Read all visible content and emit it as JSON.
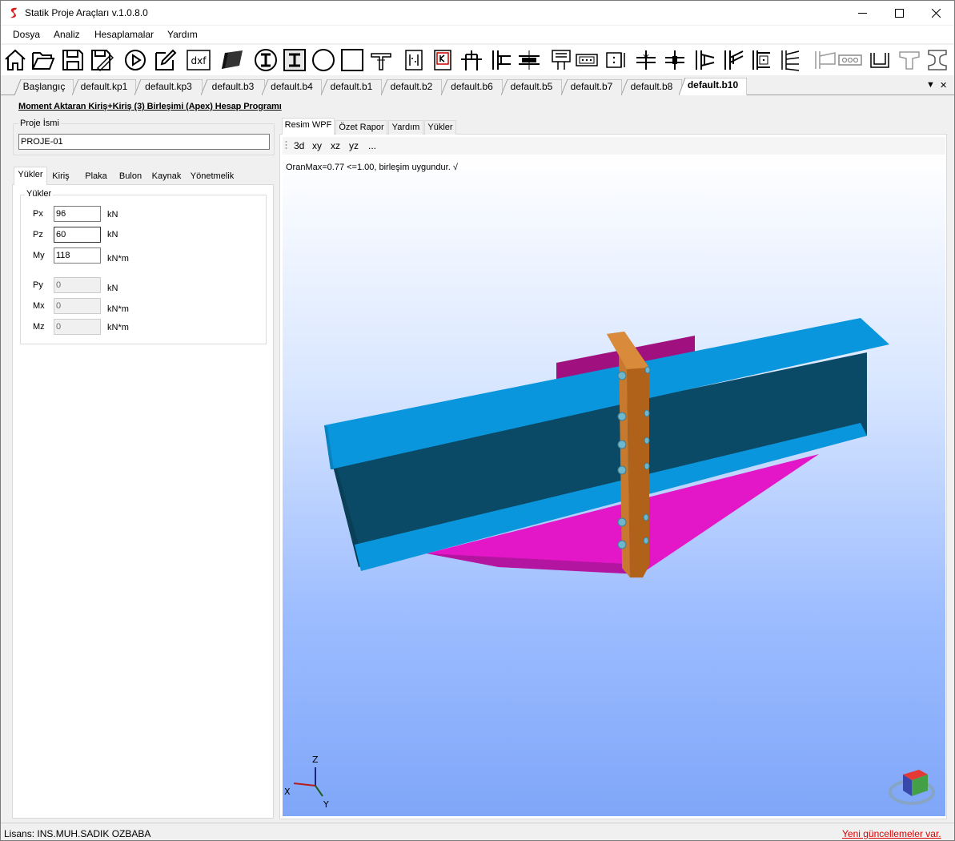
{
  "window": {
    "title": "Statik Proje Araçları v.1.0.8.0"
  },
  "menu": {
    "items": [
      "Dosya",
      "Analiz",
      "Hesaplamalar",
      "Yardım"
    ]
  },
  "toolbar": {
    "icons": [
      "home-icon",
      "open-folder-icon",
      "save-icon",
      "save-as-icon",
      "run-icon",
      "edit-icon",
      "dxf-icon",
      "3d-shape-icon",
      "i-section-round-icon",
      "i-section-icon",
      "circle-section-icon",
      "box-section-icon",
      "tee-section-icon",
      "base-plate-icon",
      "knee-plate-icon",
      "column-cap-icon",
      "end-plate-icon",
      "beam-splice-icon",
      "plate-grid-icon",
      "bolt-plate-icon",
      "bolt-pattern-icon",
      "column-splice-icon",
      "beam-column-icon",
      "beam-column-2-icon",
      "stiffener-icon",
      "column-plate-icon",
      "column-plate-2-icon",
      "gusset-icon",
      "bolt-row-icon",
      "channel-icon",
      "tee-icon",
      "i-beam-icon"
    ],
    "dxf_label": "dxf"
  },
  "doc_tabs": [
    "Başlangıç",
    "default.kp1",
    "default.kp3",
    "default.b3",
    "default.b4",
    "default.b1",
    "default.b2",
    "default.b6",
    "default.b5",
    "default.b7",
    "default.b8",
    "default.b10"
  ],
  "program_title": "Moment Aktaran Kiriş+Kiriş (3) Birleşimi (Apex) Hesap Programı",
  "project": {
    "label": "Proje İsmi",
    "value": "PROJE-01"
  },
  "left_tabs": [
    "Yükler",
    "Kiriş",
    "Plaka",
    "Bulon",
    "Kaynak",
    "Yönetmelik"
  ],
  "loads": {
    "group_label": "Yükler",
    "fields": [
      {
        "label": "Px",
        "value": "96",
        "unit": "kN",
        "enabled": true
      },
      {
        "label": "Pz",
        "value": "60",
        "unit": "kN",
        "enabled": true
      },
      {
        "label": "My",
        "value": "118",
        "unit": "kN*m",
        "enabled": true
      },
      {
        "label": "Py",
        "value": "0",
        "unit": "kN",
        "enabled": false
      },
      {
        "label": "Mx",
        "value": "0",
        "unit": "kN*m",
        "enabled": false
      },
      {
        "label": "Mz",
        "value": "0",
        "unit": "kN*m",
        "enabled": false
      }
    ]
  },
  "right_tabs": [
    "Resim WPF",
    "Özet Rapor",
    "Yardım",
    "Yükler"
  ],
  "view_buttons": [
    "3d",
    "xy",
    "xz",
    "yz",
    "..."
  ],
  "result_text": "OranMax=0.77 <=1.00, birleşim uygundur. √",
  "axes": {
    "z": "Z",
    "x": "X",
    "y": "Y"
  },
  "status": {
    "license": "Lisans: INS.MUH.SADIK OZBABA",
    "update": "Yeni güncellemeler var."
  },
  "colors": {
    "flange": "#0a96dd",
    "web": "#0b4a66",
    "plate": "#e317c8",
    "end_plate": "#b0611a"
  }
}
